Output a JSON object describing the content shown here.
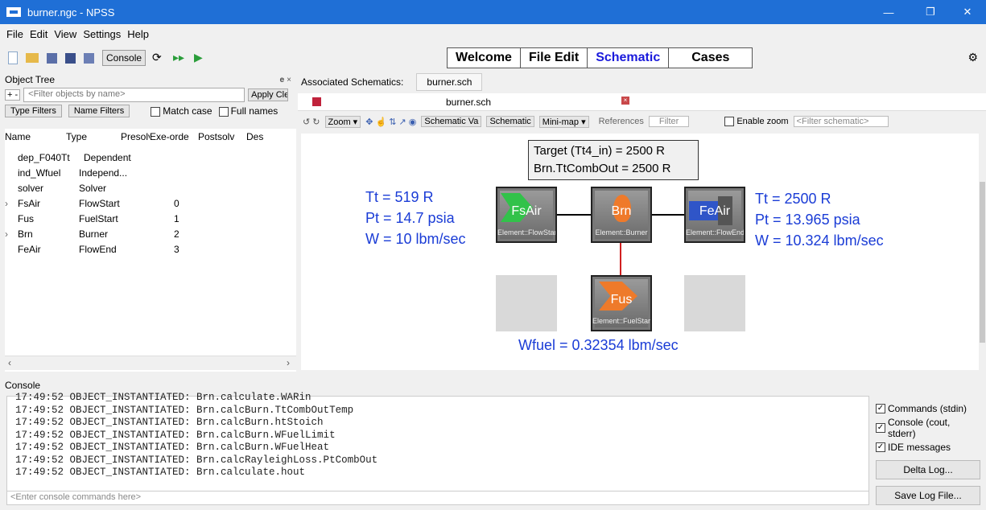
{
  "window": {
    "title": "burner.ngc - NPSS"
  },
  "menu": [
    "File",
    "Edit",
    "View",
    "Settings",
    "Help"
  ],
  "toolbar": {
    "console_label": "Console"
  },
  "nav_tabs": [
    "Welcome",
    "File Edit",
    "Schematic",
    "Cases"
  ],
  "object_tree": {
    "title": "Object Tree",
    "filter_placeholder": "<Filter objects by name>",
    "apply_clear": "Apply Clear",
    "type_filters": "Type Filters",
    "name_filters": "Name Filters",
    "match_case": "Match case",
    "full_names": "Full names",
    "columns": [
      "Name",
      "Type",
      "Presolv",
      "Exe-orde",
      "Postsolv",
      "Des"
    ],
    "rows": [
      {
        "exp": "",
        "name": "dep_F040Tt",
        "type": "Dependent",
        "pre": "",
        "exe": ""
      },
      {
        "exp": "",
        "name": "ind_Wfuel",
        "type": "Independ...",
        "pre": "",
        "exe": ""
      },
      {
        "exp": "",
        "name": "solver",
        "type": "Solver",
        "pre": "",
        "exe": ""
      },
      {
        "exp": "›",
        "name": "FsAir",
        "type": "FlowStart",
        "pre": "",
        "exe": "0"
      },
      {
        "exp": "",
        "name": "Fus",
        "type": "FuelStart",
        "pre": "",
        "exe": "1"
      },
      {
        "exp": "›",
        "name": "Brn",
        "type": "Burner",
        "pre": "",
        "exe": "2"
      },
      {
        "exp": "",
        "name": "FeAir",
        "type": "FlowEnd",
        "pre": "",
        "exe": "3"
      }
    ]
  },
  "schematic": {
    "associated_label": "Associated Schematics:",
    "associated_tab": "burner.sch",
    "doc_tab": "burner.sch",
    "zoom": "Zoom",
    "schematic_va": "Schematic Va",
    "schematic_b": "Schematic",
    "minimap": "Mini-map",
    "references": "References",
    "filter": "Filter",
    "enable_zoom": "Enable zoom",
    "filter_placeholder": "<Filter schematic>",
    "target_line1": "Target (Tt4_in) = 2500 R",
    "target_line2": "Brn.TtCombOut = 2500 R",
    "left_tt": "Tt = 519 R",
    "left_pt": "Pt = 14.7 psia",
    "left_w": "W = 10 lbm/sec",
    "right_tt": "Tt = 2500 R",
    "right_pt": "Pt = 13.965 psia",
    "right_w": "W = 10.324 lbm/sec",
    "wfuel": "Wfuel = 0.32354 lbm/sec",
    "nodes": {
      "fsair": {
        "name": "FsAir",
        "sub": "Element::FlowStart"
      },
      "brn": {
        "name": "Brn",
        "sub": "Element::Burner"
      },
      "feair": {
        "name": "FeAir",
        "sub": "Element::FlowEnd"
      },
      "fus": {
        "name": "Fus",
        "sub": "Element::FuelStart"
      }
    }
  },
  "console": {
    "title": "Console",
    "lines": [
      "17:49:52 OBJECT_INSTANTIATED: Brn.calculate.WARin",
      "17:49:52 OBJECT_INSTANTIATED: Brn.calcBurn.TtCombOutTemp",
      "17:49:52 OBJECT_INSTANTIATED: Brn.calcBurn.htStoich",
      "17:49:52 OBJECT_INSTANTIATED: Brn.calcBurn.WFuelLimit",
      "17:49:52 OBJECT_INSTANTIATED: Brn.calcBurn.WFuelHeat",
      "17:49:52 OBJECT_INSTANTIATED: Brn.calcRayleighLoss.PtCombOut",
      "17:49:52 OBJECT_INSTANTIATED: Brn.calculate.hout"
    ],
    "input_placeholder": "<Enter console commands here>",
    "commands": "Commands (stdin)",
    "console_out": "Console (cout, stderr)",
    "ide": "IDE messages",
    "delta_log": "Delta Log...",
    "save_log": "Save Log File..."
  }
}
